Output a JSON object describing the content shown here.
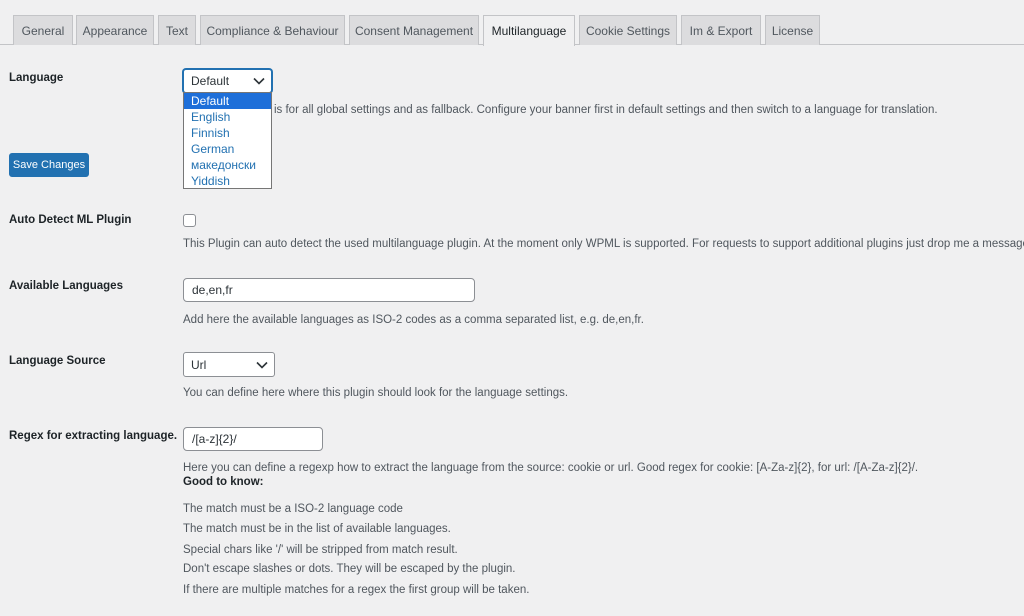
{
  "tabs": [
    {
      "label": "General"
    },
    {
      "label": "Appearance"
    },
    {
      "label": "Text"
    },
    {
      "label": "Compliance & Behaviour"
    },
    {
      "label": "Consent Management"
    },
    {
      "label": "Multilanguage"
    },
    {
      "label": "Cookie Settings"
    },
    {
      "label": "Im & Export"
    },
    {
      "label": "License"
    }
  ],
  "language": {
    "label": "Language",
    "selected": "Default",
    "options": [
      "Default",
      "English",
      "Finnish",
      "German",
      "македонски",
      "Yiddish"
    ],
    "description_visible": "ge is for all global settings and as fallback. Configure your banner first in default settings and then switch to a language for translation."
  },
  "save_button": "Save Changes",
  "auto_detect": {
    "label": "Auto Detect ML Plugin",
    "checked": false,
    "description": "This Plugin can auto detect the used multilanguage plugin. At the moment only WPML is supported. For requests to support additional plugins just drop me a message."
  },
  "available_languages": {
    "label": "Available Languages",
    "value": "de,en,fr",
    "description": "Add here the available languages as ISO-2 codes as a comma separated list, e.g. de,en,fr."
  },
  "language_source": {
    "label": "Language Source",
    "selected": "Url",
    "description": "You can define here where this plugin should look for the language settings."
  },
  "regex": {
    "label": "Regex for extracting language.",
    "value": "/[a-z]{2}/",
    "description": "Here you can define a regexp how to extract the language from the source: cookie or url. Good regex for cookie: [A-Za-z]{2}, for url: /[A-Za-z]{2}/.",
    "good_to_know": "Good to know:",
    "notes": [
      "The match must be a ISO-2 language code",
      "The match must be in the list of available languages.",
      "Special chars like '/' will be stripped from match result.",
      "Don't escape slashes or dots. They will be escaped by the plugin.",
      "If there are multiple matches for a regex the first group will be taken."
    ]
  },
  "colors": {
    "background": "#f0f0f1",
    "primary": "#2271b1",
    "dropdown_selected": "#1e6fd9"
  }
}
